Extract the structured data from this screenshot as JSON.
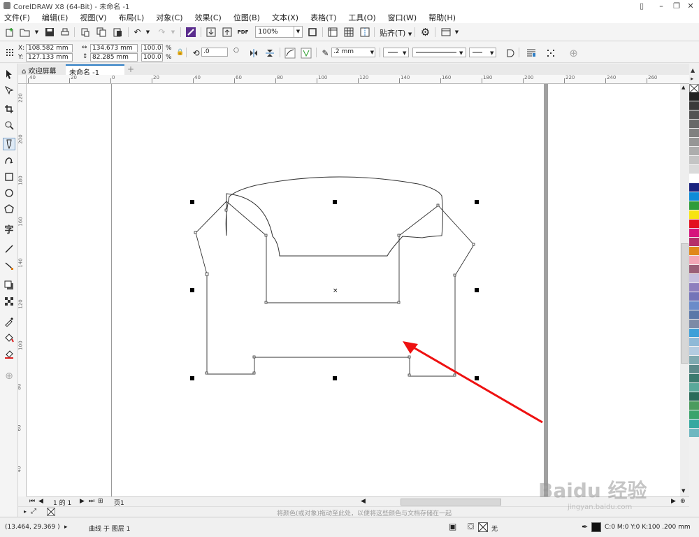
{
  "window": {
    "title": "CorelDRAW X8 (64-Bit) - 未命名 -1"
  },
  "menu": [
    "文件(F)",
    "编辑(E)",
    "视图(V)",
    "布局(L)",
    "对象(C)",
    "效果(C)",
    "位图(B)",
    "文本(X)",
    "表格(T)",
    "工具(O)",
    "窗口(W)",
    "帮助(H)"
  ],
  "toolbar": {
    "zoom": "100%",
    "snap_label": "贴齐(T)",
    "pdf_label": "PDF"
  },
  "property_bar": {
    "x": "108.582 mm",
    "y": "127.133 mm",
    "x_label": "X:",
    "y_label": "Y:",
    "width": "134.673 mm",
    "height": "82.285 mm",
    "scale_x": "100.0",
    "scale_y": "100.0",
    "percent": "%",
    "rotation": ".0",
    "outline_width": ".2 mm"
  },
  "doc_tabs": {
    "home": "欢迎屏幕",
    "active": "未命名 -1"
  },
  "rulers": {
    "h_ticks": [
      "40",
      "20",
      "0",
      "20",
      "40",
      "60",
      "80",
      "100",
      "120",
      "140",
      "160",
      "180",
      "200",
      "220",
      "240",
      "260"
    ],
    "v_ticks": [
      "220",
      "200",
      "180",
      "160",
      "140",
      "120",
      "100",
      "80",
      "60",
      "40",
      "20"
    ]
  },
  "page_nav": {
    "pages": "1 的 1",
    "tab": "页1"
  },
  "color_hint": "将颜色(或对象)拖动至此处，以便将这些颜色与文档存储在一起",
  "status": {
    "coords": "(13.464, 29.369 )",
    "object_info": "曲线 于 图层 1",
    "outline_none": "无",
    "fill_info": "C:0 M:0 Y:0 K:100  .200 mm"
  },
  "palette": [
    "#222222",
    "#3a3a3a",
    "#525252",
    "#686868",
    "#808080",
    "#969696",
    "#adadad",
    "#c4c4c4",
    "#dadada",
    "#ffffff",
    "#1a237e",
    "#0d8bd8",
    "#2e9c3a",
    "#f7e411",
    "#e3111e",
    "#d6157c",
    "#b52f6a",
    "#e0881a",
    "#f3a6b6",
    "#9b5f78",
    "#c6bfdf",
    "#8e7fbe",
    "#7474b8",
    "#6b8bc9",
    "#5a77a8",
    "#7c8aa6",
    "#3e9fd8",
    "#8fb9d7",
    "#b3cbe0",
    "#7fa9b0",
    "#5d8a8a",
    "#3b7a6e",
    "#5aa89a",
    "#2b6b5a",
    "#4b9b5e",
    "#3ba36c",
    "#35a8a0",
    "#6fb7c0"
  ],
  "watermark": {
    "main": "Baidu 经验",
    "sub": "jingyan.baidu.com"
  }
}
